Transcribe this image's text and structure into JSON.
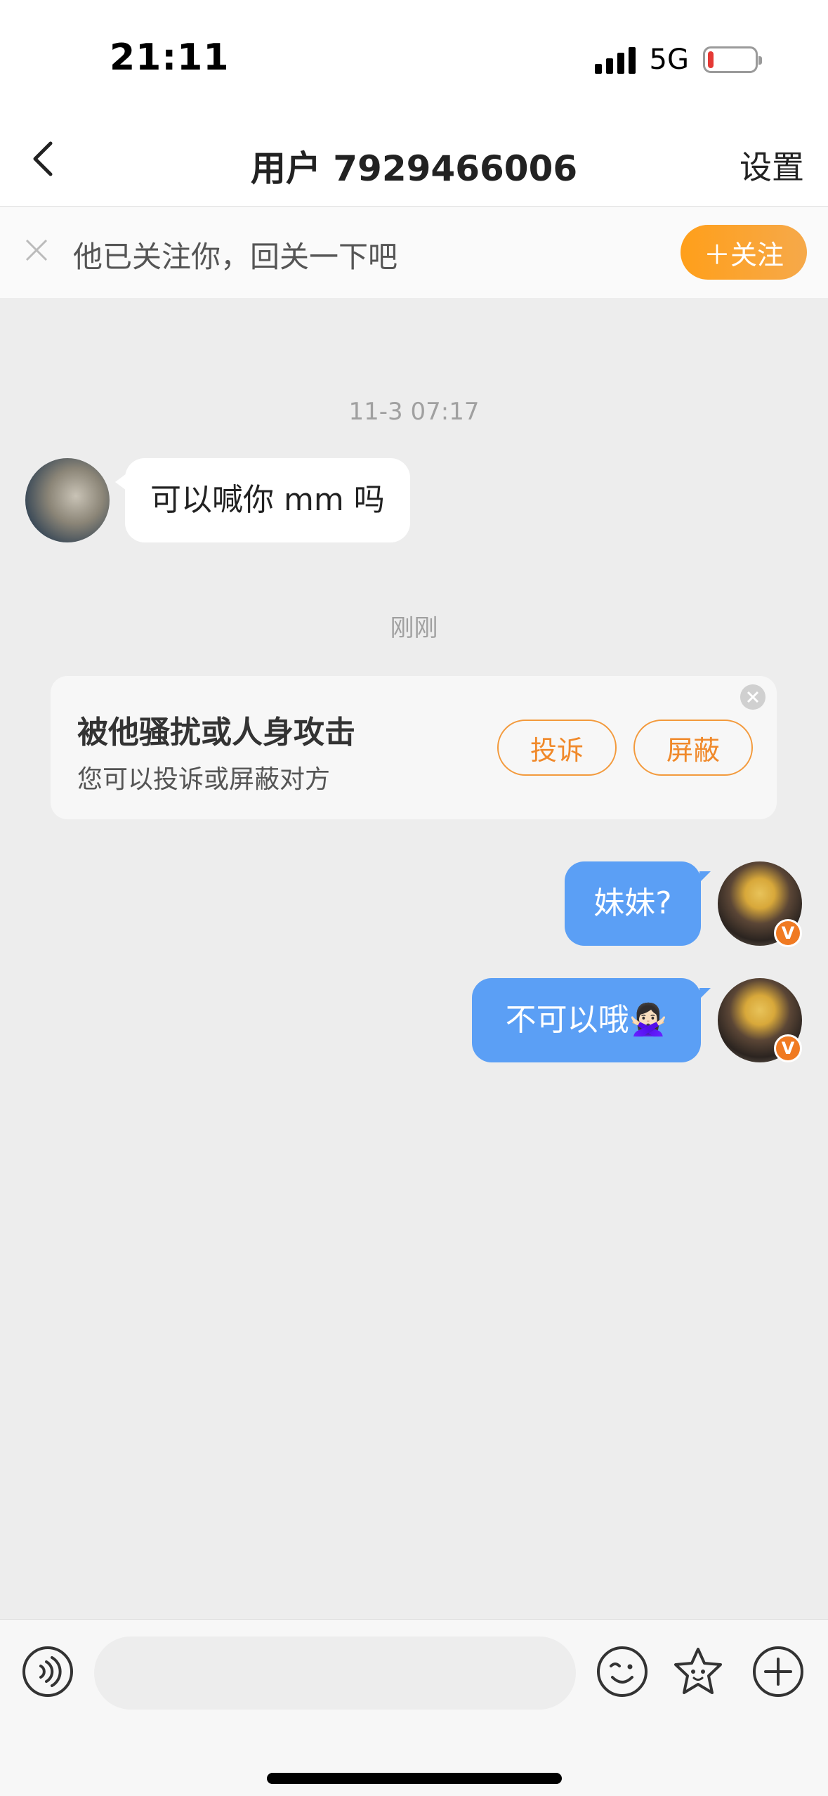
{
  "status_bar": {
    "time": "21:11",
    "network": "5G",
    "battery_level": 0.12
  },
  "header": {
    "title": "用户 7929466006",
    "settings_label": "设置"
  },
  "follow_banner": {
    "text": "他已关注你，回关一下吧",
    "button_label": "＋关注"
  },
  "chat": {
    "messages": [
      {
        "type": "time",
        "text": "11-3 07:17"
      },
      {
        "type": "incoming",
        "text": "可以喊你 mm 吗"
      },
      {
        "type": "time",
        "text": "刚刚"
      },
      {
        "type": "outgoing",
        "text": "妹妹?"
      },
      {
        "type": "outgoing",
        "text": "不可以哦🙅🏻‍♀️"
      }
    ],
    "report_card": {
      "title": "被他骚扰或人身攻击",
      "subtitle": "您可以投诉或屏蔽对方",
      "complain_label": "投诉",
      "block_label": "屏蔽"
    },
    "verified_badge": "V"
  },
  "input_bar": {
    "placeholder": ""
  },
  "colors": {
    "accent": "#f0892a",
    "outgoing_bubble": "#5b9ff5",
    "follow_button": "#ff9f1a"
  }
}
